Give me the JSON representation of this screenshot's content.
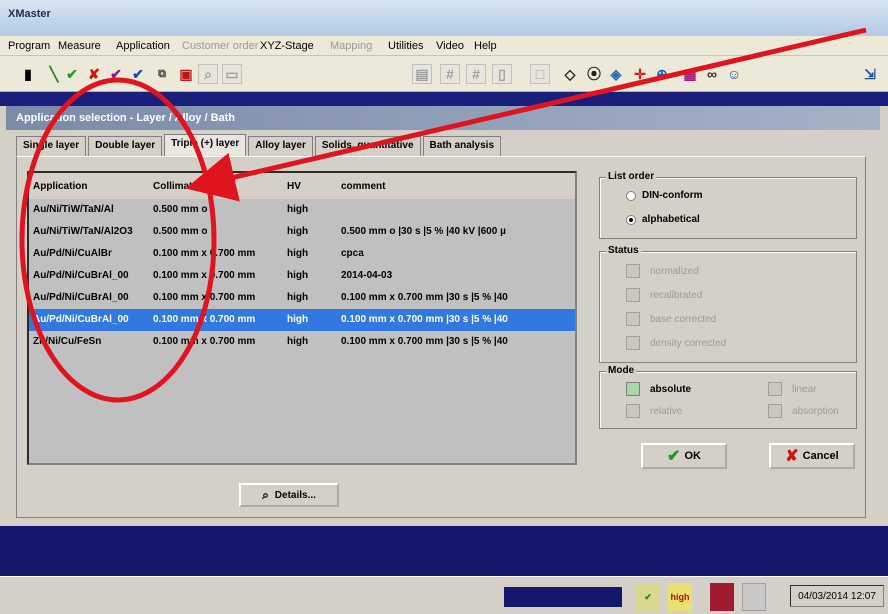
{
  "app": {
    "title": "XMaster"
  },
  "menu": [
    "Program",
    "Measure",
    "Application",
    "Customer order",
    "XYZ-Stage",
    "Mapping",
    "Utilities",
    "Video",
    "Help"
  ],
  "dialog": {
    "title": "Application selection - Layer / Alloy / Bath",
    "tabs": [
      "Single layer",
      "Double layer",
      "Triple (+) layer",
      "Alloy layer",
      "Solids, quantitative",
      "Bath analysis"
    ],
    "active_tab": "Triple (+) layer",
    "list": {
      "headers": [
        "Application",
        "Collimator",
        "HV",
        "comment"
      ],
      "rows": [
        [
          "Au/Ni/TiW/TaN/Al",
          "0.500 mm o",
          "high",
          ""
        ],
        [
          "Au/Ni/TiW/TaN/Al2O3",
          "0.500 mm o",
          "high",
          "0.500 mm o |30 s |5 % |40 kV |600 µ"
        ],
        [
          "Au/Pd/Ni/CuAlBr",
          "0.100 mm x 0.700 mm",
          "high",
          "cpca"
        ],
        [
          "Au/Pd/Ni/CuBrAl_00",
          "0.100 mm x 0.700 mm",
          "high",
          "2014-04-03"
        ],
        [
          "Au/Pd/Ni/CuBrAl_00",
          "0.100 mm x 0.700 mm",
          "high",
          "0.100 mm x 0.700 mm |30 s |5 % |40"
        ],
        [
          "Au/Pd/Ni/CuBrAl_00",
          "0.100 mm x 0.700 mm",
          "high",
          "0.100 mm x 0.700 mm |30 s |5 % |40"
        ],
        [
          "Zn/Ni/Cu/FeSn",
          "0.100 mm x 0.700 mm",
          "high",
          "0.100 mm x 0.700 mm |30 s |5 % |40"
        ]
      ],
      "selected_index": 5
    },
    "details_label": "Details...",
    "list_order": {
      "label": "List order",
      "options": [
        "DIN-conform",
        "alphabetical"
      ],
      "selected": "alphabetical"
    },
    "status": {
      "label": "Status",
      "items": [
        "normalized",
        "recalibrated",
        "base corrected",
        "density corrected"
      ]
    },
    "mode": {
      "label": "Mode",
      "items": [
        "absolute",
        "linear",
        "relative",
        "absorption"
      ],
      "checked": [
        "absolute"
      ]
    },
    "ok_label": "OK",
    "cancel_label": "Cancel"
  },
  "statusbar": {
    "hv_text": "high",
    "datetime": "04/03/2014 12:07"
  },
  "colors": {
    "navy": "#14186c",
    "selection": "#3178e0",
    "annotation": "#e0141e"
  }
}
